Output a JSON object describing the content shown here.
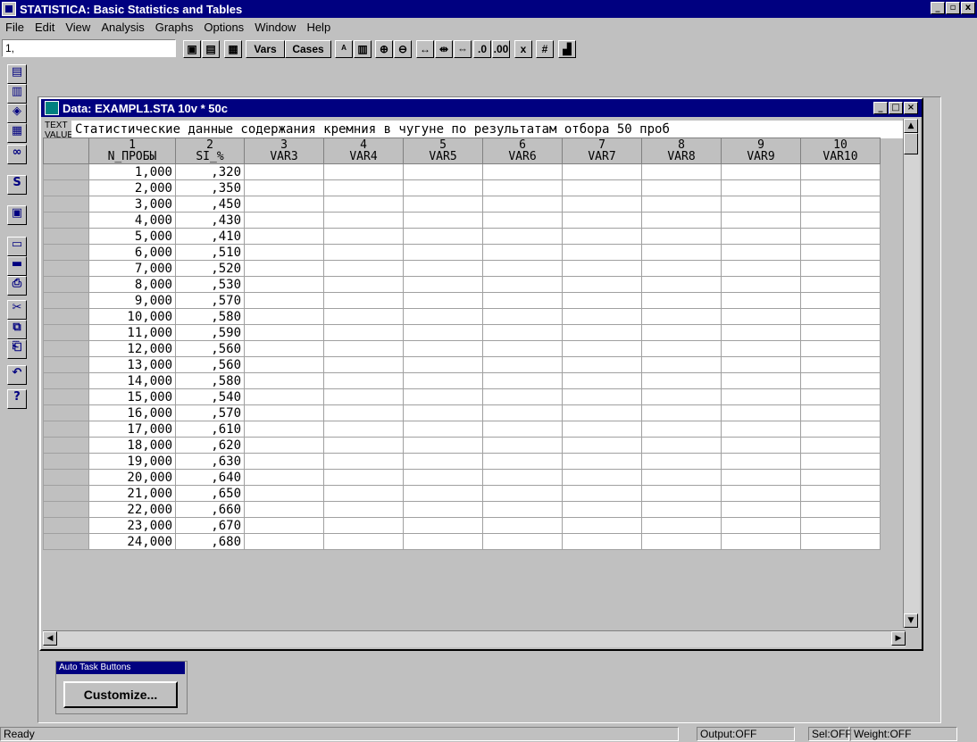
{
  "app": {
    "title": "STATISTICA: Basic Statistics and Tables",
    "minimize": "_",
    "restore": "▫",
    "close": "x"
  },
  "menu": [
    "File",
    "Edit",
    "View",
    "Analysis",
    "Graphs",
    "Options",
    "Window",
    "Help"
  ],
  "toolbar": {
    "cellref": "1,",
    "vars": "Vars",
    "cases": "Cases"
  },
  "datawin": {
    "title": "Data: EXAMPL1.STA 10v * 50c",
    "text_label": "TEXT VALUES",
    "text_value": "Статистические данные содержания кремния в чугуне по результатам отбора 50 проб"
  },
  "columns": [
    {
      "num": "1",
      "name": "N_ПРОБЫ"
    },
    {
      "num": "2",
      "name": "SI_%"
    },
    {
      "num": "3",
      "name": "VAR3"
    },
    {
      "num": "4",
      "name": "VAR4"
    },
    {
      "num": "5",
      "name": "VAR5"
    },
    {
      "num": "6",
      "name": "VAR6"
    },
    {
      "num": "7",
      "name": "VAR7"
    },
    {
      "num": "8",
      "name": "VAR8"
    },
    {
      "num": "9",
      "name": "VAR9"
    },
    {
      "num": "10",
      "name": "VAR10"
    }
  ],
  "rows": [
    [
      "1,000",
      ",320"
    ],
    [
      "2,000",
      ",350"
    ],
    [
      "3,000",
      ",450"
    ],
    [
      "4,000",
      ",430"
    ],
    [
      "5,000",
      ",410"
    ],
    [
      "6,000",
      ",510"
    ],
    [
      "7,000",
      ",520"
    ],
    [
      "8,000",
      ",530"
    ],
    [
      "9,000",
      ",570"
    ],
    [
      "10,000",
      ",580"
    ],
    [
      "11,000",
      ",590"
    ],
    [
      "12,000",
      ",560"
    ],
    [
      "13,000",
      ",560"
    ],
    [
      "14,000",
      ",580"
    ],
    [
      "15,000",
      ",540"
    ],
    [
      "16,000",
      ",570"
    ],
    [
      "17,000",
      ",610"
    ],
    [
      "18,000",
      ",620"
    ],
    [
      "19,000",
      ",630"
    ],
    [
      "20,000",
      ",640"
    ],
    [
      "21,000",
      ",650"
    ],
    [
      "22,000",
      ",660"
    ],
    [
      "23,000",
      ",670"
    ],
    [
      "24,000",
      ",680"
    ]
  ],
  "taskbox": {
    "title": "Auto Task Buttons",
    "button": "Customize..."
  },
  "status": {
    "ready": "Ready",
    "output": "Output:OFF",
    "sel": "Sel:OFF",
    "weight": "Weight:OFF"
  }
}
